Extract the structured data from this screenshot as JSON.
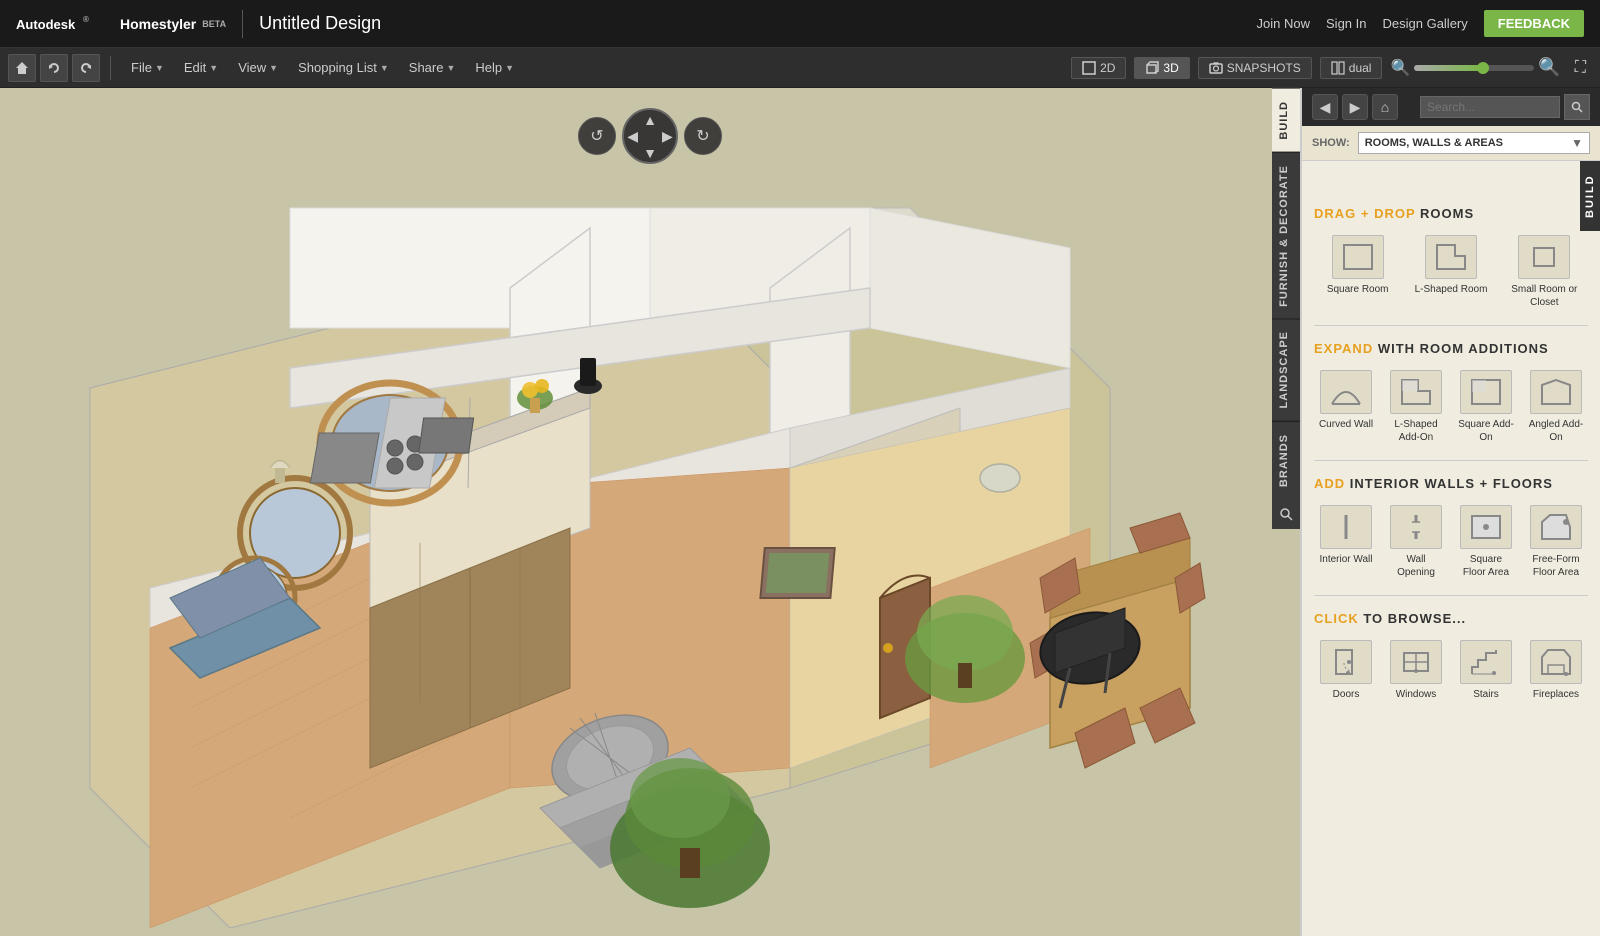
{
  "app": {
    "name": "Autodesk",
    "product": "Homestyler",
    "beta": "BETA",
    "title": "Untitled Design"
  },
  "topnav": {
    "join_now": "Join Now",
    "sign_in": "Sign In",
    "design_gallery": "Design Gallery",
    "feedback": "FEEDBACK"
  },
  "toolbar": {
    "file": "File",
    "edit": "Edit",
    "view": "View",
    "shopping_list": "Shopping List",
    "share": "Share",
    "help": "Help",
    "btn_2d": "2D",
    "btn_3d": "3D",
    "snapshots": "SNAPSHOTS",
    "dual": "dual"
  },
  "side_tabs": {
    "build": "BUILD",
    "furnish_decorate": "FURNISH & DECORATE",
    "landscape": "LANDSCAPE",
    "brands": "BRANDS"
  },
  "panel": {
    "show_label": "SHOW:",
    "show_value": "ROOMS, WALLS & AREAS",
    "search_placeholder": "Search...",
    "drag_drop_label": "DRAG + DROP",
    "rooms_label": "ROOMS",
    "expand_label": "EXPAND",
    "with_room_additions": "WITH ROOM ADDITIONS",
    "add_label": "ADD",
    "interior_walls_floors": "INTERIOR WALLS + FLOORS",
    "click_label": "CLICK",
    "to_browse": "TO BROWSE..."
  },
  "rooms": [
    {
      "id": "square-room",
      "label": "Square Room"
    },
    {
      "id": "l-shaped-room",
      "label": "L-Shaped Room"
    },
    {
      "id": "small-room",
      "label": "Small Room or Closet"
    }
  ],
  "additions": [
    {
      "id": "curved-wall",
      "label": "Curved Wall"
    },
    {
      "id": "l-shaped-addon",
      "label": "L-Shaped Add-On"
    },
    {
      "id": "square-addon",
      "label": "Square Add-On"
    },
    {
      "id": "angled-addon",
      "label": "Angled Add-On"
    }
  ],
  "walls_floors": [
    {
      "id": "interior-wall",
      "label": "Interior Wall"
    },
    {
      "id": "wall-opening",
      "label": "Wall Opening"
    },
    {
      "id": "square-floor",
      "label": "Square Floor Area"
    },
    {
      "id": "freeform-floor",
      "label": "Free-Form Floor Area"
    }
  ],
  "browse_items": [
    {
      "id": "doors",
      "label": "Doors"
    },
    {
      "id": "windows",
      "label": "Windows"
    },
    {
      "id": "stairs",
      "label": "Stairs"
    },
    {
      "id": "fireplaces",
      "label": "Fireplaces"
    }
  ],
  "colors": {
    "accent_orange": "#e8a020",
    "accent_green": "#7ab648",
    "bg_panel": "#f0ede0",
    "bg_dark": "#1a1a1a",
    "viewport_bg": "#c8c4a8"
  }
}
